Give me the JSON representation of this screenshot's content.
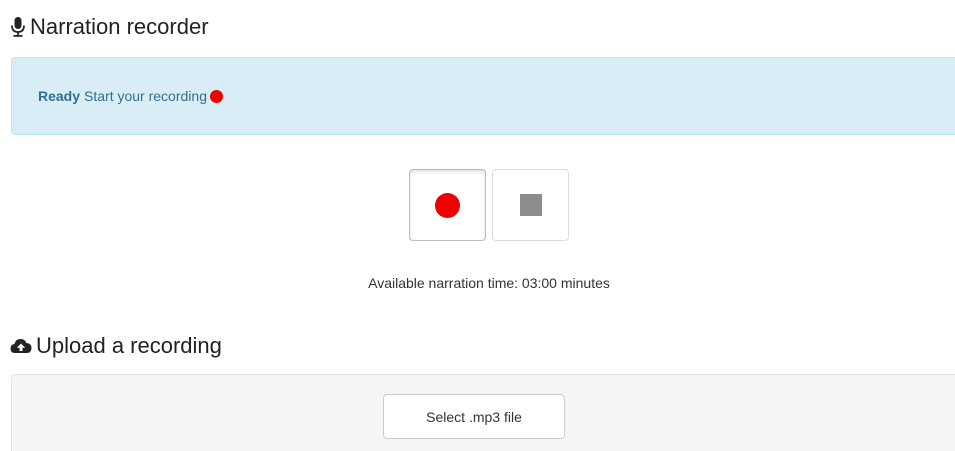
{
  "recorder": {
    "title": "Narration recorder",
    "title_icon": "microphone-icon",
    "status": {
      "label": "Ready",
      "message": "Start your recording",
      "indicator_color": "#ee0000"
    },
    "controls": {
      "record_icon": "record-icon",
      "stop_icon": "stop-icon"
    },
    "available_time": "Available narration time: 03:00 minutes"
  },
  "upload": {
    "title": "Upload a recording",
    "title_icon": "cloud-upload-icon",
    "select_button_label": "Select .mp3 file"
  },
  "colors": {
    "alert_background": "#d9edf7",
    "alert_text": "#31708f",
    "record_red": "#ee0000",
    "stop_gray": "#8c8c8c",
    "well_background": "#f5f5f5"
  }
}
